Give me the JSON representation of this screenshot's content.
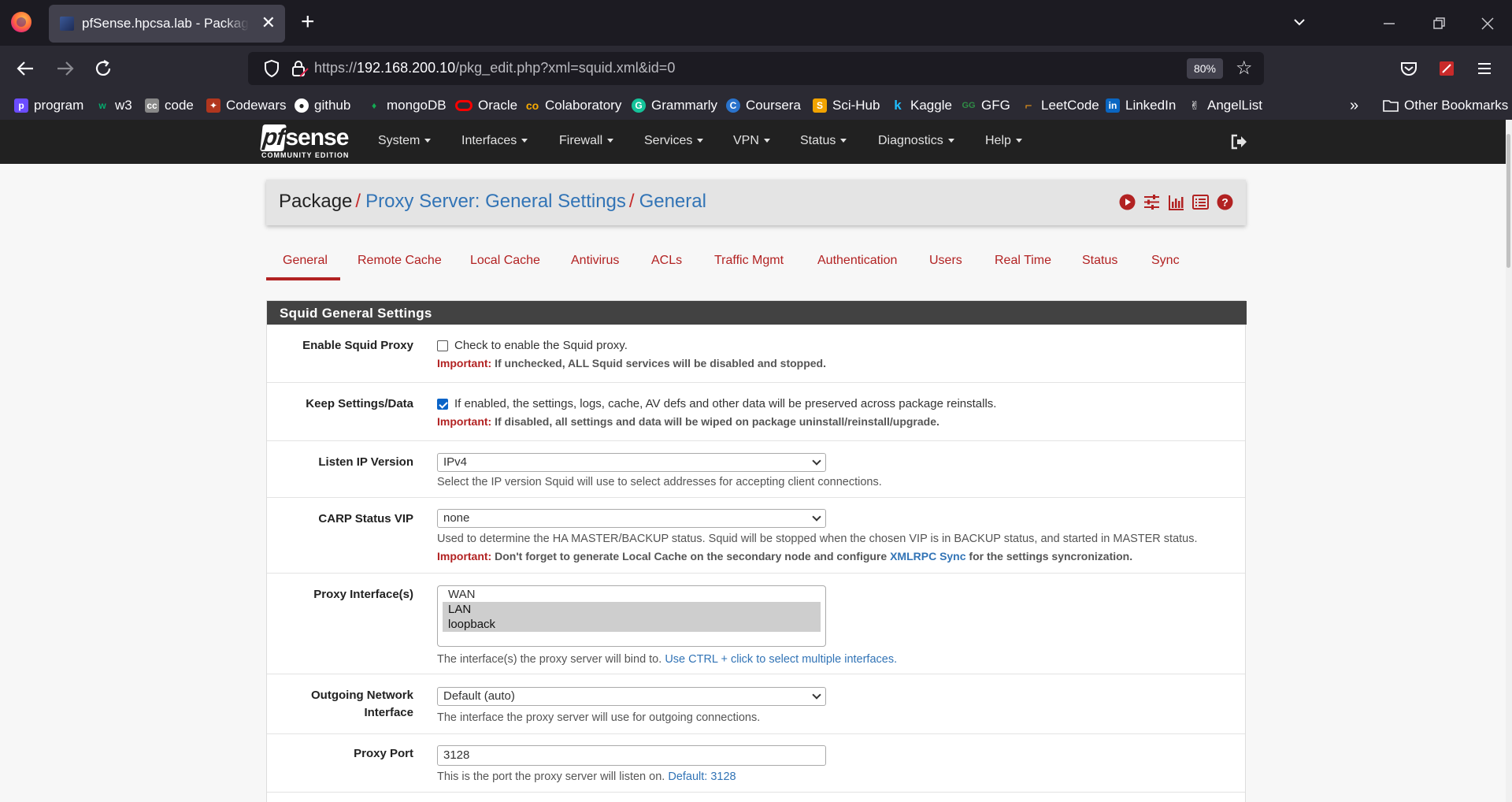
{
  "browser": {
    "tab_title": "pfSense.hpcsa.lab - Package: Proxy Server: General Settings",
    "url_prefix": "https://",
    "url_host": "192.168.200.10",
    "url_path": "/pkg_edit.php?xml=squid.xml&id=0",
    "zoom": "80%",
    "bookmarks": [
      {
        "label": "program",
        "icon": "program-icon",
        "color": "#6b4cff"
      },
      {
        "label": "w3",
        "icon": "w3schools-icon",
        "color": "#04aa6d"
      },
      {
        "label": "code",
        "icon": "code-icon",
        "color": "#888888"
      },
      {
        "label": "Codewars",
        "icon": "codewars-icon",
        "color": "#b1361e"
      },
      {
        "label": "github",
        "icon": "github-icon",
        "color": "#ffffff"
      },
      {
        "label": "mongoDB",
        "icon": "mongodb-icon",
        "color": "#13aa52"
      },
      {
        "label": "Oracle",
        "icon": "oracle-icon",
        "color": "#f80000"
      },
      {
        "label": "Colaboratory",
        "icon": "colab-icon",
        "color": "#f9ab00"
      },
      {
        "label": "Grammarly",
        "icon": "grammarly-icon",
        "color": "#15c39a"
      },
      {
        "label": "Coursera",
        "icon": "coursera-icon",
        "color": "#2a73cc"
      },
      {
        "label": "Sci-Hub",
        "icon": "scihub-icon",
        "color": "#f1a300"
      },
      {
        "label": "Kaggle",
        "icon": "kaggle-icon",
        "color": "#20beff"
      },
      {
        "label": "GFG",
        "icon": "gfg-icon",
        "color": "#2f8d46"
      },
      {
        "label": "LeetCode",
        "icon": "leetcode-icon",
        "color": "#ffa116"
      },
      {
        "label": "LinkedIn",
        "icon": "linkedin-icon",
        "color": "#0a66c2"
      },
      {
        "label": "AngelList",
        "icon": "angellist-icon",
        "color": "#ffffff"
      }
    ],
    "other_bookmarks": "Other Bookmarks"
  },
  "pfsense": {
    "logo_sub": "COMMUNITY EDITION",
    "menu": [
      "System",
      "Interfaces",
      "Firewall",
      "Services",
      "VPN",
      "Status",
      "Diagnostics",
      "Help"
    ]
  },
  "breadcrumb": {
    "root": "Package",
    "section": "Proxy Server: General Settings",
    "page": "General"
  },
  "tabs": [
    "General",
    "Remote Cache",
    "Local Cache",
    "Antivirus",
    "ACLs",
    "Traffic Mgmt",
    "Authentication",
    "Users",
    "Real Time",
    "Status",
    "Sync"
  ],
  "active_tab": "General",
  "panel": {
    "title": "Squid General Settings",
    "enable_squid": {
      "label": "Enable Squid Proxy",
      "checked": false,
      "text": "Check to enable the Squid proxy.",
      "important_label": "Important:",
      "important_text": " If unchecked, ALL Squid services will be disabled and stopped."
    },
    "keep_settings": {
      "label": "Keep Settings/Data",
      "checked": true,
      "text": "If enabled, the settings, logs, cache, AV defs and other data will be preserved across package reinstalls.",
      "important_label": "Important:",
      "important_text": " If disabled, all settings and data will be wiped on package uninstall/reinstall/upgrade."
    },
    "listen_ip": {
      "label": "Listen IP Version",
      "value": "IPv4",
      "help": "Select the IP version Squid will use to select addresses for accepting client connections."
    },
    "carp_vip": {
      "label": "CARP Status VIP",
      "value": "none",
      "help": "Used to determine the HA MASTER/BACKUP status. Squid will be stopped when the chosen VIP is in BACKUP status, and started in MASTER status.",
      "important_label": "Important:",
      "important_text_a": " Don't forget to generate Local Cache on the secondary node and configure ",
      "important_link": "XMLRPC Sync",
      "important_text_b": " for the settings syncronization."
    },
    "proxy_interfaces": {
      "label": "Proxy Interface(s)",
      "options": [
        "WAN",
        "LAN",
        "loopback"
      ],
      "selected": [
        false,
        true,
        true
      ],
      "help": "The interface(s) the proxy server will bind to. ",
      "help_link": "Use CTRL + click to select multiple interfaces."
    },
    "outgoing_iface": {
      "label_line1": "Outgoing Network",
      "label_line2": "Interface",
      "value": "Default (auto)",
      "help": "The interface the proxy server will use for outgoing connections."
    },
    "proxy_port": {
      "label": "Proxy Port",
      "value": "3128",
      "help": "This is the port the proxy server will listen on. ",
      "help_link": "Default: 3128"
    }
  }
}
